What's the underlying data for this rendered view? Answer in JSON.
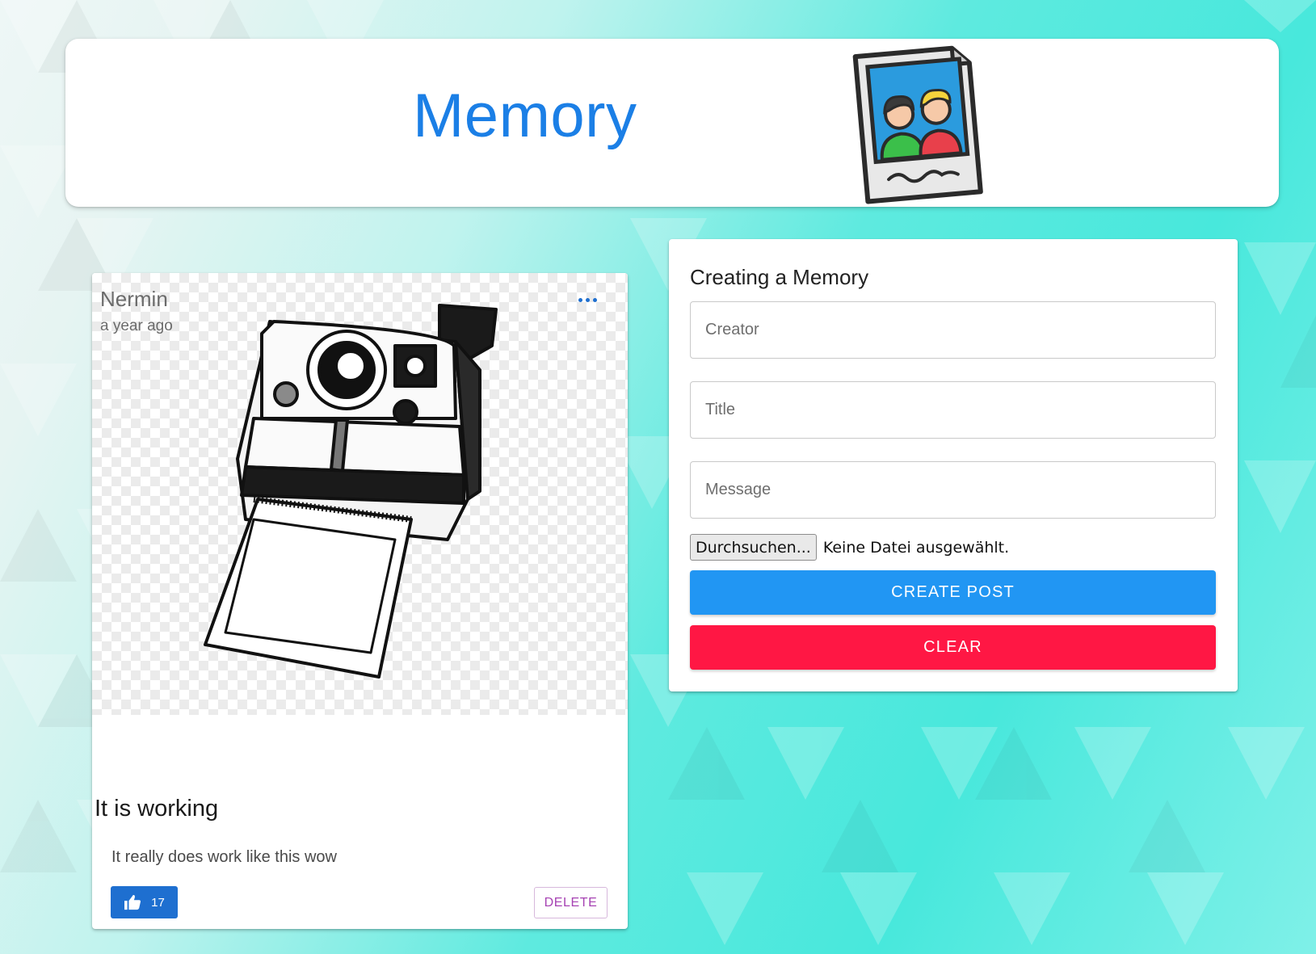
{
  "header": {
    "title": "Memory",
    "logo_icon": "polaroid-photo-icon",
    "title_color": "#1b7fe6"
  },
  "posts": [
    {
      "creator": "Nermin",
      "time": "a year ago",
      "image_icon": "polaroid-camera-icon",
      "title": "It is working",
      "message": "It really does work like this wow",
      "like_count": "17",
      "delete_label": "DELETE",
      "more_icon": "more-horizontal-icon"
    }
  ],
  "form": {
    "heading": "Creating a Memory",
    "creator_placeholder": "Creator",
    "title_placeholder": "Title",
    "message_placeholder": "Message",
    "file_button_label": "Durchsuchen...",
    "file_status": "Keine Datei ausgewählt.",
    "submit_label": "CREATE POST",
    "clear_label": "CLEAR"
  },
  "colors": {
    "primary": "#2196f3",
    "secondary": "#ff1744",
    "like": "#1e6fd0",
    "delete": "#a642b3"
  }
}
